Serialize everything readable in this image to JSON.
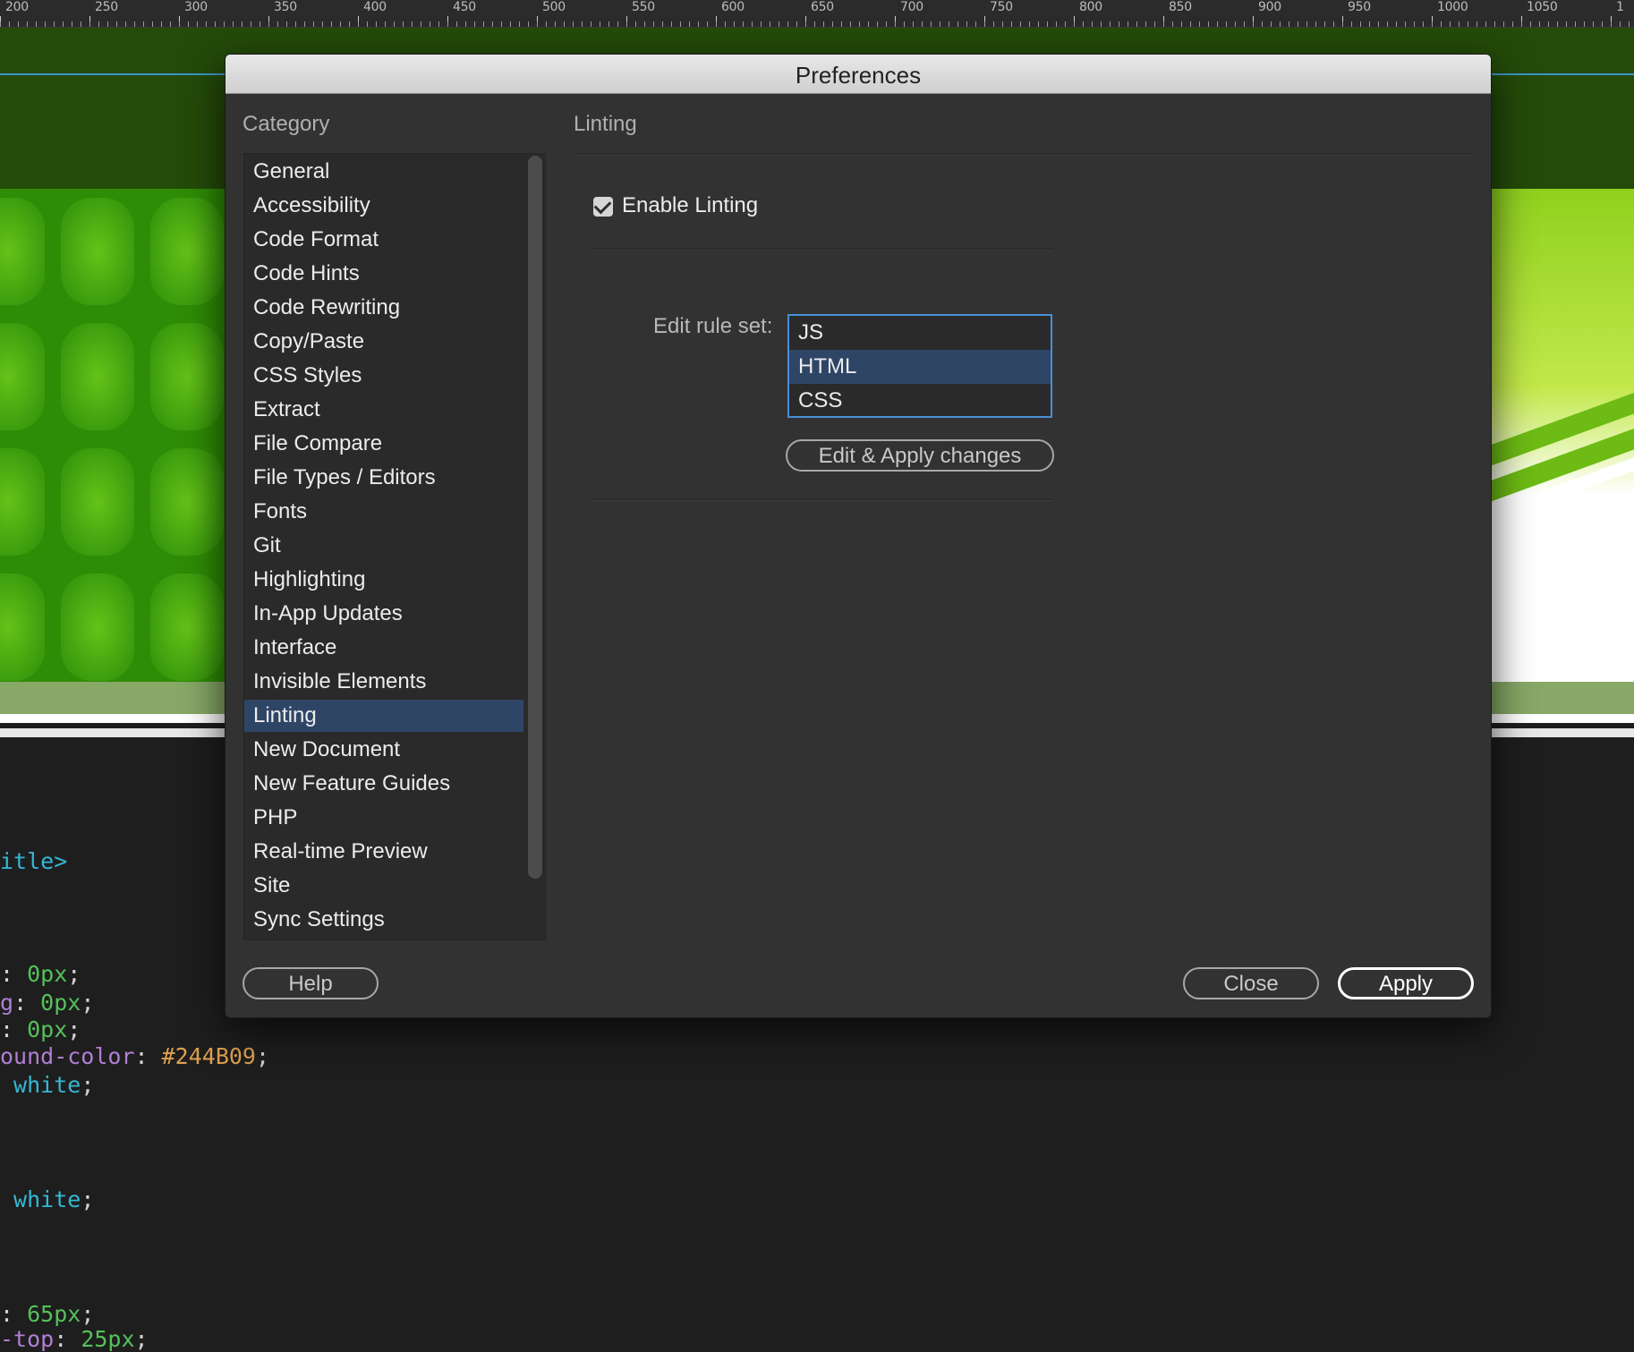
{
  "ruler": {
    "labels": [
      "200",
      "250",
      "300",
      "350",
      "400",
      "450",
      "500",
      "550",
      "600",
      "650",
      "700",
      "750",
      "800",
      "850",
      "900",
      "950",
      "1000",
      "1050",
      "1"
    ]
  },
  "code": {
    "lines": [
      {
        "parts": [
          {
            "t": "itle>",
            "c": "cyan"
          }
        ]
      },
      {
        "parts": [
          {
            "t": ": ",
            "c": "plain"
          },
          {
            "t": "0px",
            "c": "green"
          },
          {
            "t": ";",
            "c": "plain"
          }
        ]
      },
      {
        "parts": [
          {
            "t": "g",
            "c": "purple"
          },
          {
            "t": ": ",
            "c": "plain"
          },
          {
            "t": "0px",
            "c": "green"
          },
          {
            "t": ";",
            "c": "plain"
          }
        ]
      },
      {
        "parts": [
          {
            "t": ": ",
            "c": "plain"
          },
          {
            "t": "0px",
            "c": "green"
          },
          {
            "t": ";",
            "c": "plain"
          }
        ]
      },
      {
        "parts": [
          {
            "t": "ound-color",
            "c": "purple"
          },
          {
            "t": ": ",
            "c": "plain"
          },
          {
            "t": "#244B09",
            "c": "orange"
          },
          {
            "t": ";",
            "c": "plain"
          }
        ]
      },
      {
        "parts": [
          {
            "t": " white",
            "c": "cyan"
          },
          {
            "t": ";",
            "c": "plain"
          }
        ]
      },
      {
        "parts": [
          {
            "t": " white",
            "c": "cyan"
          },
          {
            "t": ";",
            "c": "plain"
          }
        ]
      },
      {
        "parts": [
          {
            "t": ": ",
            "c": "plain"
          },
          {
            "t": "65px",
            "c": "green"
          },
          {
            "t": ";",
            "c": "plain"
          }
        ]
      },
      {
        "parts": [
          {
            "t": "-top",
            "c": "purple"
          },
          {
            "t": ": ",
            "c": "plain"
          },
          {
            "t": "25px",
            "c": "green"
          },
          {
            "t": ";",
            "c": "plain"
          }
        ]
      }
    ]
  },
  "dialog": {
    "title": "Preferences",
    "category_heading": "Category",
    "categories": [
      "General",
      "Accessibility",
      "Code Format",
      "Code Hints",
      "Code Rewriting",
      "Copy/Paste",
      "CSS Styles",
      "Extract",
      "File Compare",
      "File Types / Editors",
      "Fonts",
      "Git",
      "Highlighting",
      "In-App Updates",
      "Interface",
      "Invisible Elements",
      "Linting",
      "New Document",
      "New Feature Guides",
      "PHP",
      "Real-time Preview",
      "Site",
      "Sync Settings"
    ],
    "selected_category": "Linting",
    "panel": {
      "heading": "Linting",
      "enable_linting": {
        "label": "Enable Linting",
        "checked": true
      },
      "rule_set_label": "Edit rule set:",
      "rule_sets": [
        "JS",
        "HTML",
        "CSS"
      ],
      "selected_rule_set": "HTML",
      "edit_apply_label": "Edit  & Apply changes"
    },
    "buttons": {
      "help": "Help",
      "close": "Close",
      "apply": "Apply"
    }
  },
  "colors": {
    "dialog_bg": "#323232",
    "selection": "#2e4566",
    "focus_border": "#4a8fd6",
    "page_header": "#244b09"
  }
}
